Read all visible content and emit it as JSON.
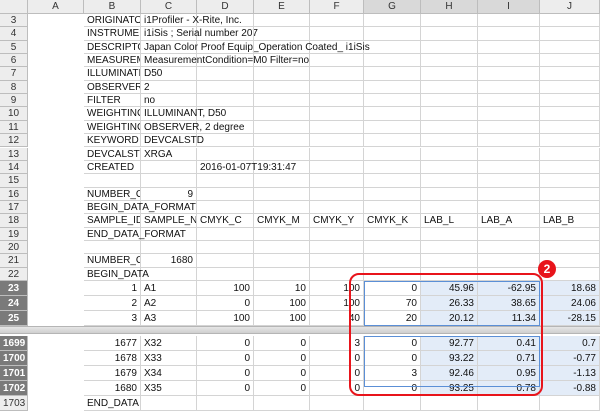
{
  "columns": [
    "A",
    "B",
    "C",
    "D",
    "E",
    "F",
    "G",
    "H",
    "I",
    "J"
  ],
  "rows": [
    {
      "n": "3",
      "cells": [
        "ORIGINATOR",
        "i1Profiler - X-Rite, Inc.",
        "",
        "",
        "",
        "",
        "",
        "",
        "",
        ""
      ]
    },
    {
      "n": "4",
      "cells": [
        "INSTRUMENT",
        "i1iSis ; Serial number 207",
        "",
        "",
        "",
        "",
        "",
        "",
        "",
        ""
      ]
    },
    {
      "n": "5",
      "cells": [
        "DESCRIPTOR",
        "Japan Color Proof Equip_Operation Coated_ i1iSis",
        "",
        "",
        "",
        "",
        "",
        "",
        "",
        ""
      ]
    },
    {
      "n": "6",
      "cells": [
        "MEASUREME",
        "MeasurementCondition=M0 Filter=no",
        "",
        "",
        "",
        "",
        "",
        "",
        "",
        ""
      ]
    },
    {
      "n": "7",
      "cells": [
        "ILLUMINATIO",
        "D50",
        "",
        "",
        "",
        "",
        "",
        "",
        "",
        ""
      ]
    },
    {
      "n": "8",
      "cells": [
        "OBSERVER_A",
        "2",
        "",
        "",
        "",
        "",
        "",
        "",
        "",
        ""
      ]
    },
    {
      "n": "9",
      "cells": [
        "FILTER",
        "no",
        "",
        "",
        "",
        "",
        "",
        "",
        "",
        ""
      ]
    },
    {
      "n": "10",
      "cells": [
        "WEIGHTING_I",
        "ILLUMINANT, D50",
        "",
        "",
        "",
        "",
        "",
        "",
        "",
        ""
      ]
    },
    {
      "n": "11",
      "cells": [
        "WEIGHTING_I",
        "OBSERVER, 2 degree",
        "",
        "",
        "",
        "",
        "",
        "",
        "",
        ""
      ]
    },
    {
      "n": "12",
      "cells": [
        "KEYWORD",
        "DEVCALSTD",
        "",
        "",
        "",
        "",
        "",
        "",
        "",
        ""
      ]
    },
    {
      "n": "13",
      "cells": [
        "DEVCALSTD",
        "XRGA",
        "",
        "",
        "",
        "",
        "",
        "",
        "",
        ""
      ]
    },
    {
      "n": "14",
      "cells": [
        "CREATED",
        "",
        "2016-01-07T19:31:47",
        "",
        "",
        "",
        "",
        "",
        "",
        ""
      ]
    },
    {
      "n": "15",
      "cells": [
        "",
        "",
        "",
        "",
        "",
        "",
        "",
        "",
        "",
        ""
      ]
    },
    {
      "n": "16",
      "cells": [
        "NUMBER_OF",
        "9",
        "",
        "",
        "",
        "",
        "",
        "",
        "",
        ""
      ]
    },
    {
      "n": "17",
      "cells": [
        "BEGIN_DATA_FORMAT",
        "",
        "",
        "",
        "",
        "",
        "",
        "",
        "",
        ""
      ]
    },
    {
      "n": "18",
      "cells": [
        "SAMPLE_ID",
        "SAMPLE_NAI",
        "CMYK_C",
        "CMYK_M",
        "CMYK_Y",
        "CMYK_K",
        "LAB_L",
        "LAB_A",
        "LAB_B",
        ""
      ]
    },
    {
      "n": "19",
      "cells": [
        "END_DATA_FORMAT",
        "",
        "",
        "",
        "",
        "",
        "",
        "",
        "",
        ""
      ]
    },
    {
      "n": "20",
      "cells": [
        "",
        "",
        "",
        "",
        "",
        "",
        "",
        "",
        "",
        ""
      ]
    },
    {
      "n": "21",
      "cells": [
        "NUMBER_OF",
        "1680",
        "",
        "",
        "",
        "",
        "",
        "",
        "",
        ""
      ]
    },
    {
      "n": "22",
      "cells": [
        "BEGIN_DATA",
        "",
        "",
        "",
        "",
        "",
        "",
        "",
        "",
        ""
      ]
    },
    {
      "n": "23",
      "cells": [
        "1",
        "A1",
        "100",
        "10",
        "100",
        "0",
        "45.96",
        "-62.95",
        "18.68",
        ""
      ]
    },
    {
      "n": "24",
      "cells": [
        "2",
        "A2",
        "0",
        "100",
        "100",
        "70",
        "26.33",
        "38.65",
        "24.06",
        ""
      ]
    },
    {
      "n": "25",
      "cells": [
        "3",
        "A3",
        "100",
        "100",
        "40",
        "20",
        "20.12",
        "11.34",
        "-28.15",
        ""
      ]
    },
    {
      "n": "1699",
      "cells": [
        "1677",
        "X32",
        "0",
        "0",
        "3",
        "0",
        "92.77",
        "0.41",
        "0.7",
        ""
      ]
    },
    {
      "n": "1700",
      "cells": [
        "1678",
        "X33",
        "0",
        "0",
        "0",
        "0",
        "93.22",
        "0.71",
        "-0.77",
        ""
      ]
    },
    {
      "n": "1701",
      "cells": [
        "1679",
        "X34",
        "0",
        "0",
        "0",
        "3",
        "92.46",
        "0.95",
        "-1.13",
        ""
      ]
    },
    {
      "n": "1702",
      "cells": [
        "1680",
        "X35",
        "0",
        "0",
        "0",
        "0",
        "93.25",
        "0.78",
        "-0.88",
        ""
      ]
    },
    {
      "n": "1703",
      "cells": [
        "END_DATA",
        "",
        "",
        "",
        "",
        "",
        "",
        "",
        "",
        ""
      ]
    }
  ],
  "badge": "2"
}
